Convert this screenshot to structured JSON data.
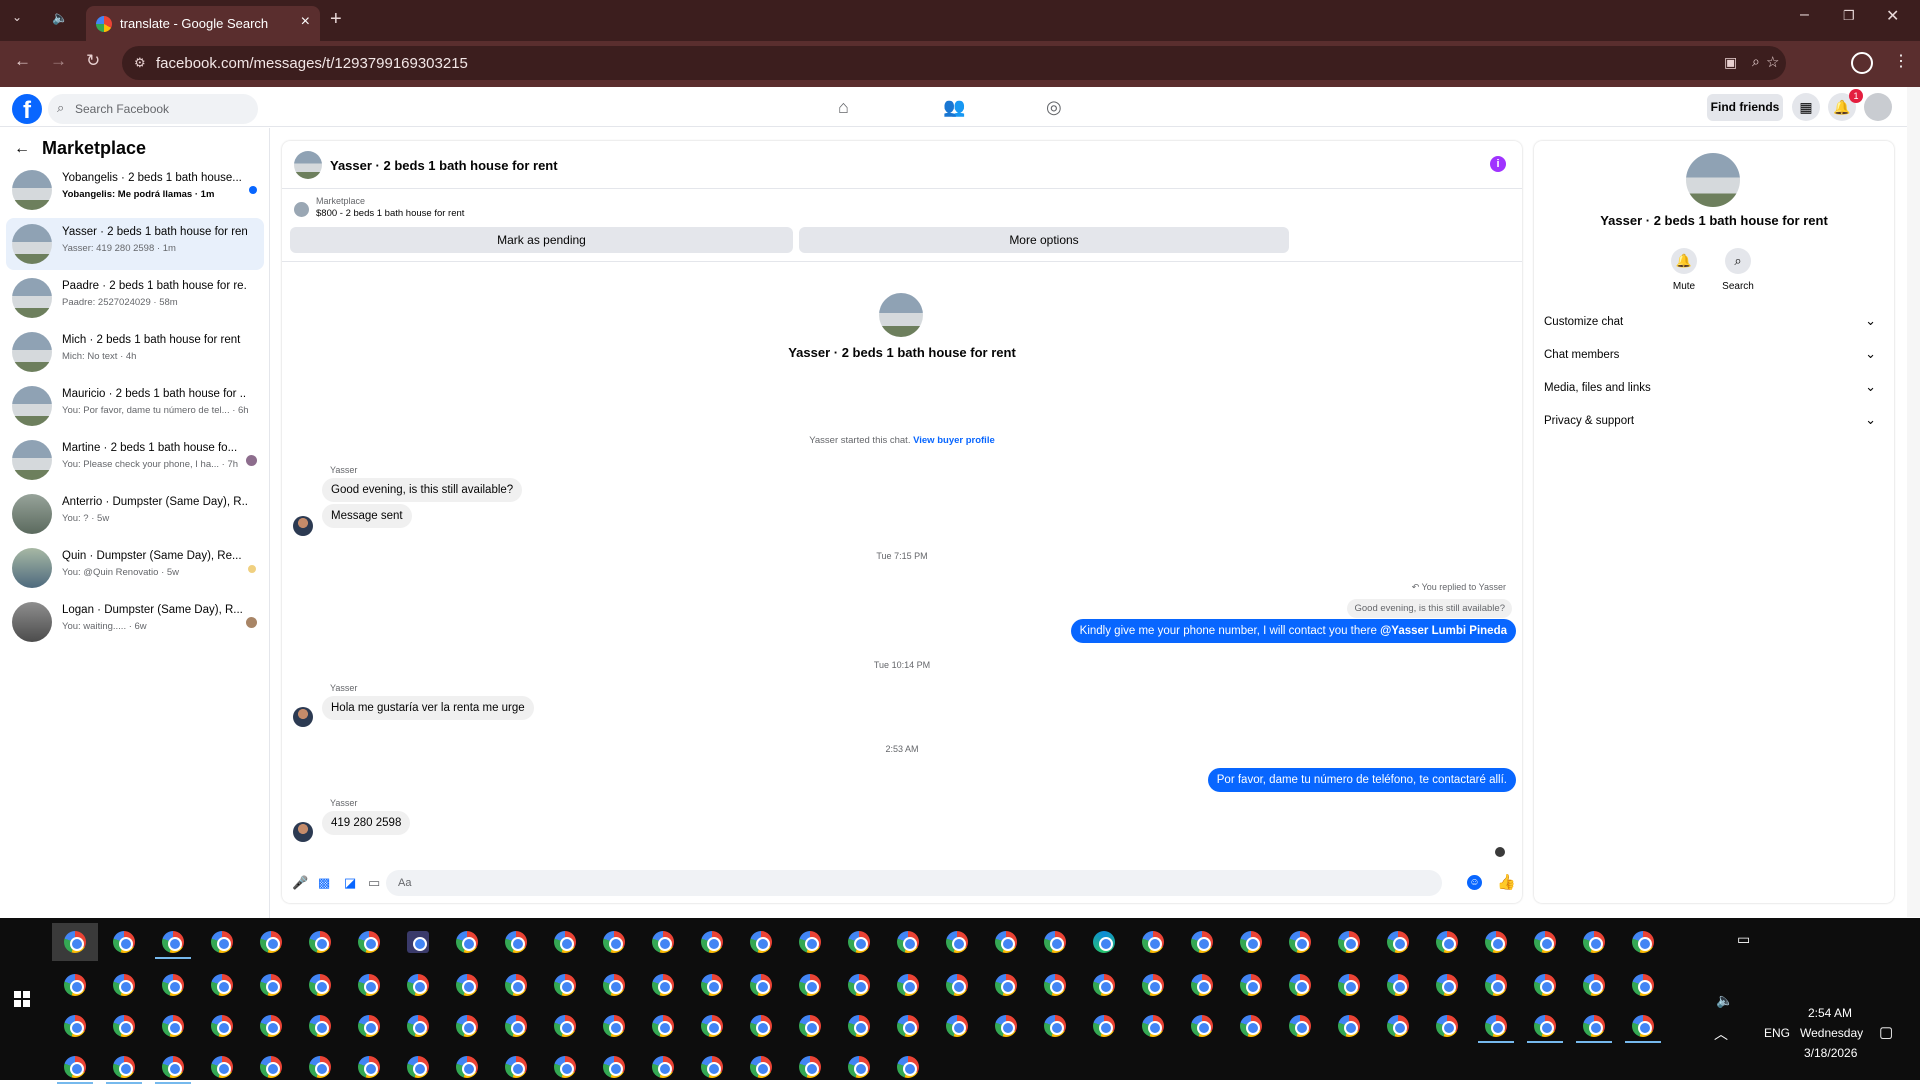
{
  "browser": {
    "tab_title": "translate - Google Search",
    "url": "facebook.com/messages/t/1293799169303215"
  },
  "fb_header": {
    "search_placeholder": "Search Facebook",
    "find_friends": "Find friends",
    "notification_count": "1"
  },
  "sidebar": {
    "title": "Marketplace",
    "conversations": [
      {
        "name": "Yobangelis · 2 beds 1 bath house...",
        "preview": "Yobangelis: Me podrá llamas · 1m",
        "unread": true
      },
      {
        "name": "Yasser · 2 beds 1 bath house for rent",
        "preview": "Yasser: 419 280 2598 · 1m",
        "selected": true
      },
      {
        "name": "Paadre · 2 beds 1 bath house for re...",
        "preview": "Paadre: 2527024029 · 58m"
      },
      {
        "name": "Mich · 2 beds 1 bath house for rent",
        "preview": "Mich: No text · 4h"
      },
      {
        "name": "Mauricio · 2 beds 1 bath house for ...",
        "preview": "You: Por favor, dame tu número de tel... · 6h"
      },
      {
        "name": "Martine · 2 beds 1 bath house fo...",
        "preview": "You: Please check your phone, I ha... · 7h"
      },
      {
        "name": "Anterrio · Dumpster (Same Day), R...",
        "preview": "You: ? · 5w"
      },
      {
        "name": "Quin · Dumpster (Same Day), Re...",
        "preview": "You: @Quin Renovatio · 5w"
      },
      {
        "name": "Logan · Dumpster (Same Day), R...",
        "preview": "You: waiting..... · 6w"
      }
    ]
  },
  "chat": {
    "title": "Yasser · 2 beds 1 bath house for rent",
    "marketplace_label": "Marketplace",
    "listing": "$800 - 2 beds 1 bath house for rent",
    "mark_pending": "Mark as pending",
    "more_options": "More options",
    "intro_name": "Yasser · 2 beds 1 bath house for rent",
    "started_text": "Yasser started this chat.",
    "view_buyer": "View buyer profile",
    "sender": "Yasser",
    "msg1": "Good evening, is this still available?",
    "msg2": "Message sent",
    "ts1": "Tue 7:15 PM",
    "replied_label": "You replied to Yasser",
    "quoted": "Good evening, is this still available?",
    "out1_text": "Kindly give me your phone number, I will contact you there ",
    "out1_mention": "@Yasser Lumbi Pineda",
    "ts2": "Tue 10:14 PM",
    "msg3": "Hola me gustaría ver la renta me urge",
    "ts3": "2:53 AM",
    "out2": "Por favor, dame tu número de teléfono, te contactaré allí.",
    "msg4": "419 280 2598",
    "composer_placeholder": "Aa"
  },
  "right_panel": {
    "name": "Yasser · 2 beds 1 bath house for rent",
    "mute": "Mute",
    "search": "Search",
    "sections": [
      "Customize chat",
      "Chat members",
      "Media, files and links",
      "Privacy & support"
    ]
  },
  "taskbar": {
    "lang": "ENG",
    "time": "2:54 AM",
    "day": "Wednesday",
    "date": "3/18/2026"
  }
}
